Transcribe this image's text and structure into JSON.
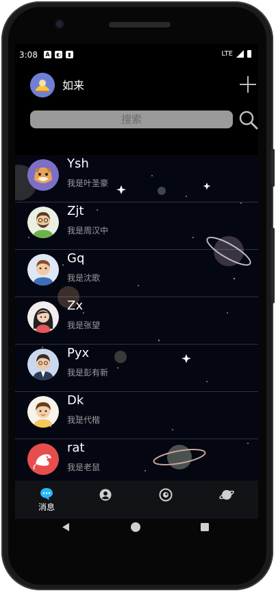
{
  "status_bar": {
    "time": "3:08",
    "left_icons": [
      "A",
      "◐",
      "▮"
    ],
    "network": "LTE"
  },
  "header": {
    "user_name": "如来"
  },
  "search": {
    "placeholder": "搜索"
  },
  "contacts": [
    {
      "name": "Ysh",
      "message": "我是叶圣豪",
      "avatar": "shiba-dog-avatar"
    },
    {
      "name": "Zjt",
      "message": "我是周汉中",
      "avatar": "bearded-man-avatar"
    },
    {
      "name": "Gq",
      "message": "我是沈歌",
      "avatar": "man-avatar"
    },
    {
      "name": "Zx",
      "message": "我是张望",
      "avatar": "woman-avatar"
    },
    {
      "name": "Pyx",
      "message": "我是彭有新",
      "avatar": "businessman-avatar"
    },
    {
      "name": "Dk",
      "message": "我是代楷",
      "avatar": "boy-avatar"
    },
    {
      "name": "rat",
      "message": "我是老鼠",
      "avatar": "rat-logo-avatar"
    }
  ],
  "tabs": [
    {
      "label": "消息",
      "icon": "chat-bubble-icon",
      "active": true
    },
    {
      "label": "",
      "icon": "contacts-icon"
    },
    {
      "label": "",
      "icon": "discover-icon"
    },
    {
      "label": "",
      "icon": "planet-icon"
    }
  ],
  "colors": {
    "accent": "#29b6f6",
    "background": "#000000"
  }
}
